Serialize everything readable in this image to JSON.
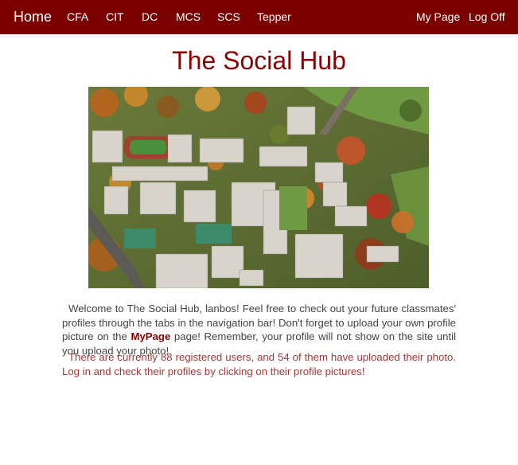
{
  "nav": {
    "home": "Home",
    "tabs": [
      "CFA",
      "CIT",
      "DC",
      "MCS",
      "SCS",
      "Tepper"
    ],
    "my_page": "My Page",
    "log_off": "Log Off"
  },
  "page_title": "The Social Hub",
  "hero_image": {
    "alt": "Aerial view of campus in autumn"
  },
  "welcome": {
    "text_before": "Welcome to The Social Hub, lanbos! Feel free to check out your future classmates' profiles through the tabs in the navigation bar! Don't forget to upload your own profile picture on the ",
    "link": "MyPage",
    "text_after": " page! Remember, your profile will not show on the site until you upload your photo!"
  },
  "stats_text": "There are currently 88 registered users, and 54 of them have uploaded their photo. Log in and check their profiles by clicking on their profile pictures!",
  "colors": {
    "navbar": "#7a0000",
    "title": "#8b0000",
    "body_text": "#444444",
    "stats_text": "#a0393a"
  }
}
